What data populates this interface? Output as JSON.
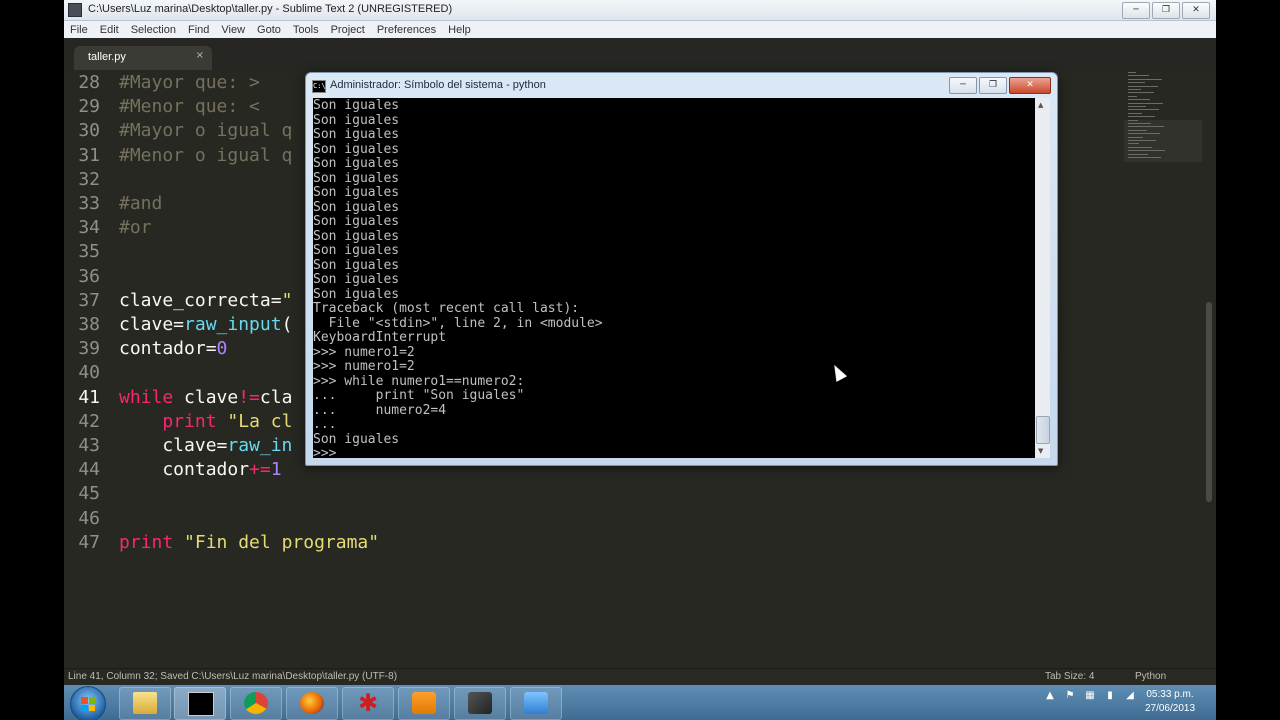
{
  "window": {
    "title": "C:\\Users\\Luz marina\\Desktop\\taller.py - Sublime Text 2 (UNREGISTERED)",
    "buttons": [
      "minimize",
      "maximize",
      "close"
    ]
  },
  "menubar": [
    "File",
    "Edit",
    "Selection",
    "Find",
    "View",
    "Goto",
    "Tools",
    "Project",
    "Preferences",
    "Help"
  ],
  "tabs": [
    {
      "label": "taller.py",
      "close": "×"
    }
  ],
  "editor": {
    "active_line": 41,
    "lines": [
      {
        "n": "28",
        "tokens": [
          {
            "t": "comment",
            "s": "#Mayor que: >"
          }
        ]
      },
      {
        "n": "29",
        "tokens": [
          {
            "t": "comment",
            "s": "#Menor que: <"
          }
        ]
      },
      {
        "n": "30",
        "tokens": [
          {
            "t": "comment",
            "s": "#Mayor o igual q"
          }
        ]
      },
      {
        "n": "31",
        "tokens": [
          {
            "t": "comment",
            "s": "#Menor o igual q"
          }
        ]
      },
      {
        "n": "32",
        "tokens": []
      },
      {
        "n": "33",
        "tokens": [
          {
            "t": "comment",
            "s": "#and"
          }
        ]
      },
      {
        "n": "34",
        "tokens": [
          {
            "t": "comment",
            "s": "#or"
          }
        ]
      },
      {
        "n": "35",
        "tokens": []
      },
      {
        "n": "36",
        "tokens": []
      },
      {
        "n": "37",
        "tokens": [
          {
            "t": "plain",
            "s": "clave_correcta="
          },
          {
            "t": "string",
            "s": "\""
          }
        ]
      },
      {
        "n": "38",
        "tokens": [
          {
            "t": "plain",
            "s": "clave="
          },
          {
            "t": "func",
            "s": "raw_input"
          },
          {
            "t": "plain",
            "s": "("
          }
        ]
      },
      {
        "n": "39",
        "tokens": [
          {
            "t": "plain",
            "s": "contador="
          },
          {
            "t": "number",
            "s": "0"
          }
        ]
      },
      {
        "n": "40",
        "tokens": []
      },
      {
        "n": "41",
        "tokens": [
          {
            "t": "keyword",
            "s": "while"
          },
          {
            "t": "plain",
            "s": " clave"
          },
          {
            "t": "keyword",
            "s": "!="
          },
          {
            "t": "plain",
            "s": "cla"
          }
        ]
      },
      {
        "n": "42",
        "tokens": [
          {
            "t": "plain",
            "s": "    "
          },
          {
            "t": "keyword",
            "s": "print"
          },
          {
            "t": "plain",
            "s": " "
          },
          {
            "t": "string",
            "s": "\"La cl"
          }
        ]
      },
      {
        "n": "43",
        "tokens": [
          {
            "t": "plain",
            "s": "    clave="
          },
          {
            "t": "func",
            "s": "raw_in"
          }
        ]
      },
      {
        "n": "44",
        "tokens": [
          {
            "t": "plain",
            "s": "    contador"
          },
          {
            "t": "keyword",
            "s": "+="
          },
          {
            "t": "number",
            "s": "1"
          }
        ]
      },
      {
        "n": "45",
        "tokens": []
      },
      {
        "n": "46",
        "tokens": []
      },
      {
        "n": "47",
        "tokens": [
          {
            "t": "keyword",
            "s": "print"
          },
          {
            "t": "plain",
            "s": " "
          },
          {
            "t": "string",
            "s": "\"Fin del programa\""
          }
        ]
      }
    ]
  },
  "statusbar": {
    "left": "Line 41, Column 32; Saved C:\\Users\\Luz marina\\Desktop\\taller.py (UTF-8)",
    "tab_size": "Tab Size: 4",
    "syntax": "Python"
  },
  "console": {
    "title": "Administrador: Símbolo del sistema - python",
    "icon_label": "C:\\",
    "lines": [
      "Son iguales",
      "Son iguales",
      "Son iguales",
      "Son iguales",
      "Son iguales",
      "Son iguales",
      "Son iguales",
      "Son iguales",
      "Son iguales",
      "Son iguales",
      "Son iguales",
      "Son iguales",
      "Son iguales",
      "Son iguales",
      "Traceback (most recent call last):",
      "  File \"<stdin>\", line 2, in <module>",
      "KeyboardInterrupt",
      ">>> numero1=2",
      ">>> numero1=2",
      ">>> while numero1==numero2:",
      "...     print \"Son iguales\"",
      "...     numero2=4",
      "...",
      "Son iguales",
      ">>> "
    ]
  },
  "taskbar": {
    "apps": [
      "explorer-icon",
      "cmd-icon",
      "chrome-icon",
      "firefox-icon",
      "app-star-icon",
      "sublime-icon",
      "tool-icon",
      "remote-icon"
    ],
    "clock_time": "05:33 p.m.",
    "clock_date": "27/06/2013"
  },
  "colors": {
    "editor_bg": "#272822",
    "comment": "#75715e",
    "keyword": "#f92672",
    "string": "#e6db74",
    "func": "#66d9ef",
    "number": "#ae81ff"
  }
}
